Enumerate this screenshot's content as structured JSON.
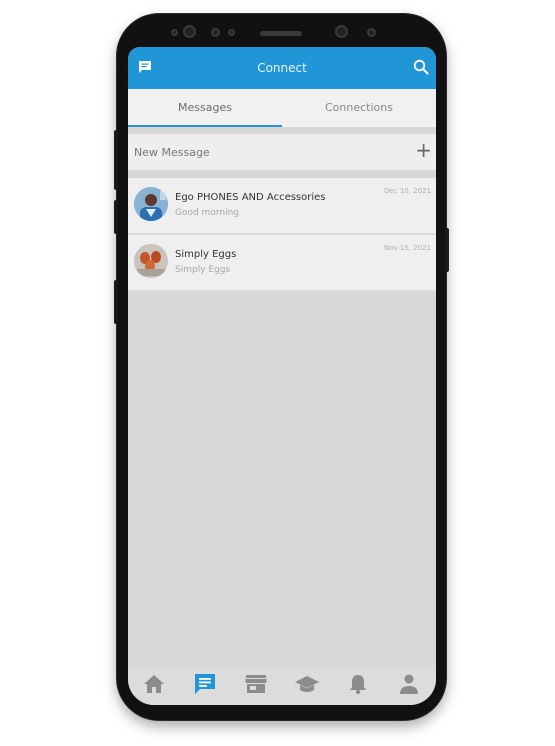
{
  "header": {
    "title": "Connect",
    "left_icon": "chat-icon",
    "right_icon": "search-icon",
    "accent_color": "#2196d7"
  },
  "tabs": [
    {
      "label": "Messages",
      "active": true
    },
    {
      "label": "Connections",
      "active": false
    }
  ],
  "new_message": {
    "label": "New Message",
    "icon": "plus-icon"
  },
  "conversations": [
    {
      "name": "Ego PHONES AND Accessories",
      "preview": "Good morning",
      "date": "Dec 10, 2021"
    },
    {
      "name": "Simply Eggs",
      "preview": "Simply Eggs",
      "date": "Nov 15, 2021"
    }
  ],
  "bottom_nav": [
    {
      "icon": "home-icon",
      "active": false
    },
    {
      "icon": "messages-icon",
      "active": true
    },
    {
      "icon": "store-icon",
      "active": false
    },
    {
      "icon": "graduation-cap-icon",
      "active": false
    },
    {
      "icon": "bell-icon",
      "active": false
    },
    {
      "icon": "person-icon",
      "active": false
    }
  ]
}
